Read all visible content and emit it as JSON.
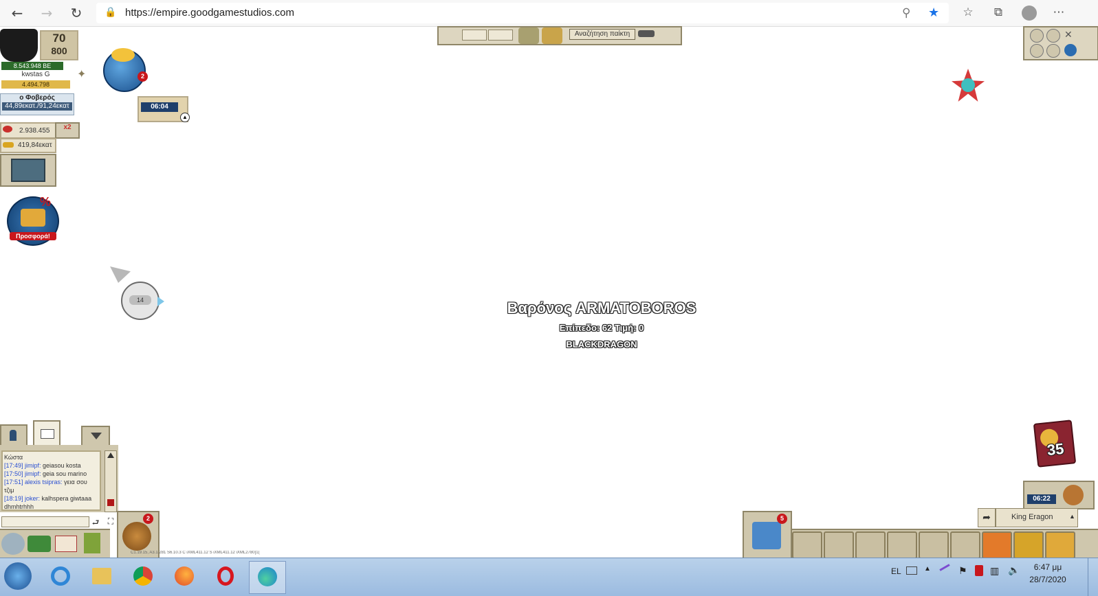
{
  "browser": {
    "url": "https://empire.goodgamestudios.com",
    "icons": [
      "back-icon",
      "forward-icon",
      "reload-icon",
      "lock-icon",
      "zoom-icon",
      "star-icon",
      "favorites-icon",
      "collections-icon",
      "profile-icon",
      "more-icon"
    ]
  },
  "player": {
    "level": "70",
    "sub_level": "800",
    "currency": "8.543.948 BE",
    "name": "kwstas G",
    "points": "4.494.798",
    "title": "ο Φοβερός",
    "progress": "44,89εκατ./91,24εκατ",
    "resource1": "2.938.455",
    "resource2": "419,84εκατ",
    "multiplier": "x2"
  },
  "events": {
    "event_badge": "2",
    "timer": "06:04",
    "offer_label": "Προσφορά!",
    "offer_percent": "%",
    "compass_count": "14"
  },
  "top_bar": {
    "search_label": "Αναζήτηση παίκτη"
  },
  "center": {
    "name": "Βαρόνος ARMATOBOROS",
    "stats": "Επίπεδο: 62 Τιμή: 0",
    "alliance": "BLACKDRAGON"
  },
  "chat": {
    "header": "Κώστα",
    "messages": [
      {
        "time": "[17:49] jimipf:",
        "text": " geiasou kosta"
      },
      {
        "time": "[17:50] jimipf:",
        "text": " geia sou   marino"
      },
      {
        "time": "[17:51] alexis tsipras:",
        "text": " γεια σου τζιμ"
      },
      {
        "time": "[18:19] joker:",
        "text": " kalhspera  giwtaaa dhmhtrhhh"
      }
    ],
    "attack_badge": "2",
    "version": "C1.19.15, A3.1.281 S6.10.3 C iXML411.12 S iXML411.12 iXML2780[1("
  },
  "bottom_right": {
    "chest_count": "35",
    "timer": "06:22",
    "gift_badge": "5",
    "king_name": "King Eragon"
  },
  "taskbar": {
    "language": "EL",
    "time": "6:47 μμ",
    "date": "28/7/2020"
  }
}
